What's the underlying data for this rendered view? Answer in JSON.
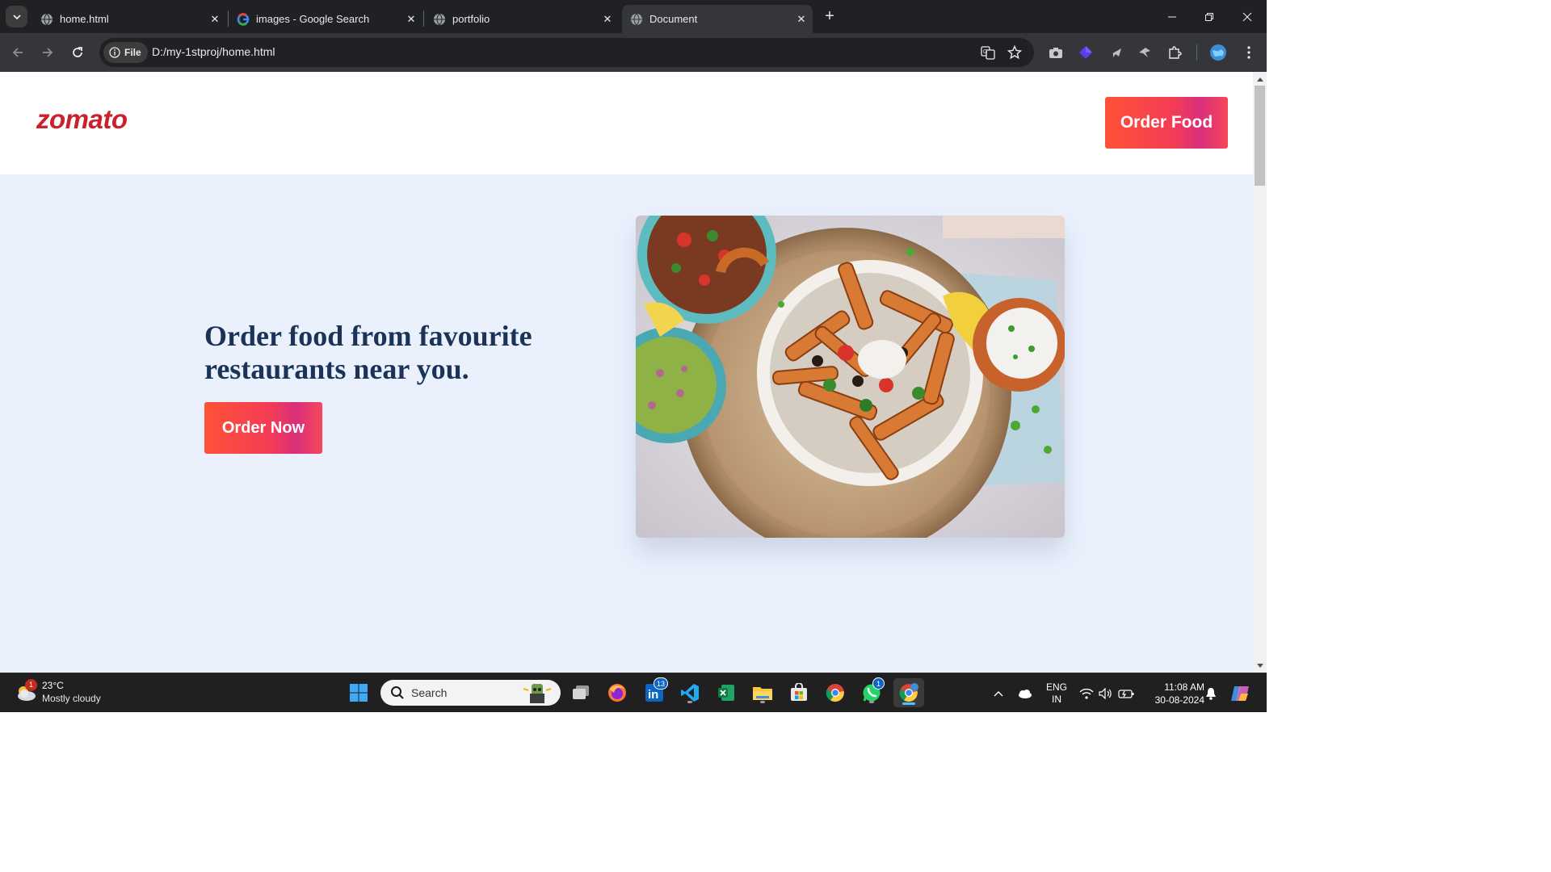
{
  "browser": {
    "tabs": [
      {
        "title": "home.html",
        "favicon": "globe-icon",
        "active": false
      },
      {
        "title": "images - Google Search",
        "favicon": "google-icon",
        "active": false
      },
      {
        "title": "portfolio",
        "favicon": "globe-icon",
        "active": false
      },
      {
        "title": "Document",
        "favicon": "globe-icon",
        "active": true
      }
    ],
    "address": {
      "chip_label": "File",
      "url": "D:/my-1stproj/home.html"
    }
  },
  "page": {
    "logo": "zomato",
    "header_button": "Order Food",
    "headline": "Order food from favourite restaurants near you.",
    "cta_button": "Order Now",
    "hero_image": "food-bowl-image",
    "colors": {
      "brand_red": "#cb202d",
      "button_gradient_start": "#fe5237",
      "button_gradient_end": "#d92f7a",
      "hero_background": "#eaf1fd",
      "headline": "#1c3358"
    }
  },
  "taskbar": {
    "weather": {
      "temp": "23°C",
      "condition": "Mostly cloudy",
      "badge": "1"
    },
    "search_placeholder": "Search",
    "linkedin_badge": "13",
    "whatsapp_badge": "1",
    "language_line1": "ENG",
    "language_line2": "IN",
    "time": "11:08 AM",
    "date": "30-08-2024"
  }
}
